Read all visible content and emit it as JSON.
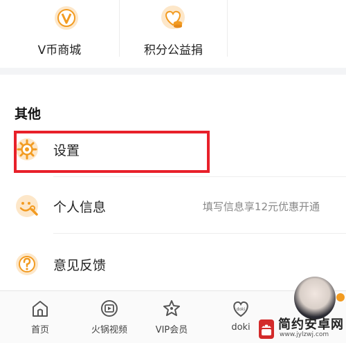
{
  "quick_grid": [
    {
      "label": "V币商城",
      "icon": "v-coin-icon"
    },
    {
      "label": "积分公益捐",
      "icon": "heart-coin-icon"
    }
  ],
  "other": {
    "title": "其他",
    "items": [
      {
        "label": "设置",
        "icon": "gear-icon"
      },
      {
        "label": "个人信息",
        "icon": "smile-wrench-icon",
        "hint": "填写信息享12元优惠开通"
      },
      {
        "label": "意见反馈",
        "icon": "question-icon"
      }
    ]
  },
  "bottom_nav": [
    {
      "label": "首页",
      "icon": "home-icon"
    },
    {
      "label": "火锅视频",
      "icon": "film-icon"
    },
    {
      "label": "VIP会员",
      "icon": "vip-star-icon"
    },
    {
      "label": "doki",
      "icon": "doki-heart-icon"
    }
  ],
  "watermark": {
    "title": "简约安卓网",
    "url": "www.jylzwj.com"
  },
  "colors": {
    "accent": "#f29b21",
    "highlight": "#e8202a",
    "text": "#222222"
  }
}
